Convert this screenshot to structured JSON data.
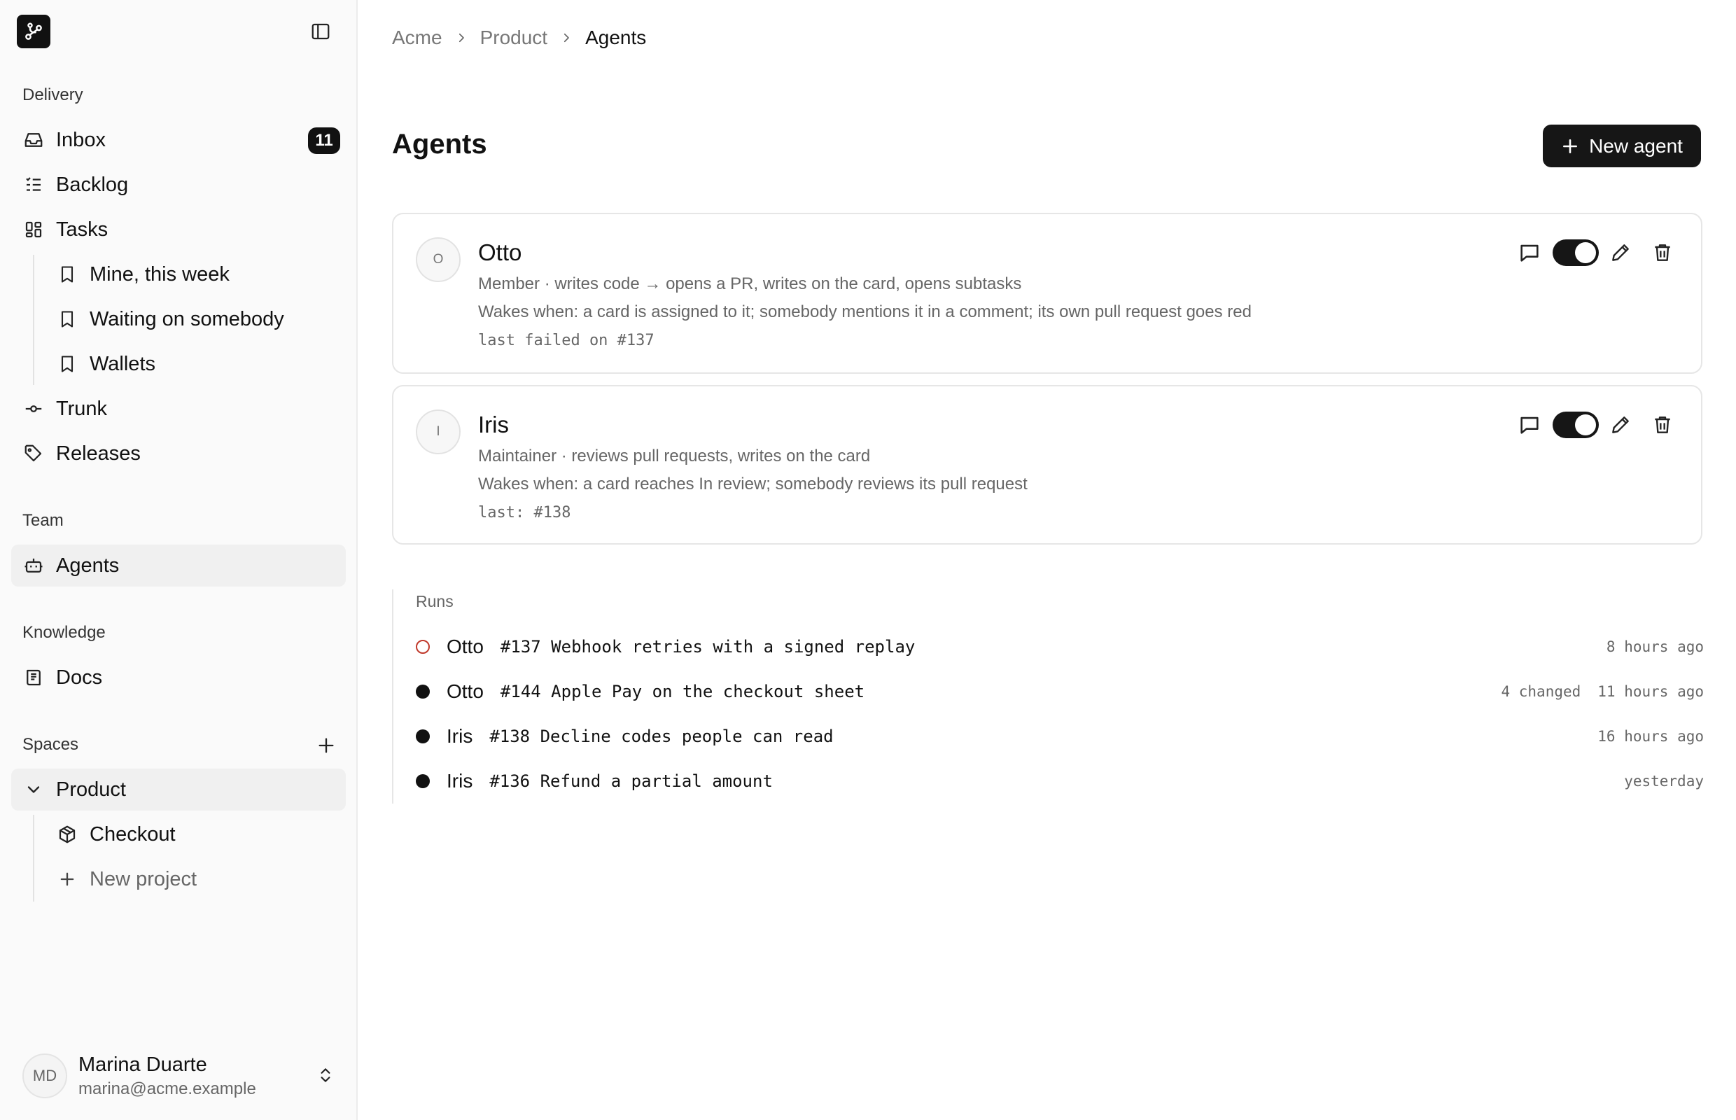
{
  "sidebar": {
    "logo_icon": "branch-logo-icon",
    "sections": {
      "delivery": "Delivery",
      "team": "Team",
      "knowledge": "Knowledge",
      "spaces": "Spaces"
    },
    "items": {
      "inbox": {
        "label": "Inbox",
        "badge": "11",
        "icon": "inbox-icon"
      },
      "backlog": {
        "label": "Backlog",
        "icon": "list-icon"
      },
      "tasks": {
        "label": "Tasks",
        "icon": "grid-icon"
      },
      "mine": {
        "label": "Mine, this week",
        "icon": "bookmark-icon"
      },
      "waiting": {
        "label": "Waiting on somebody",
        "icon": "bookmark-icon"
      },
      "wallets": {
        "label": "Wallets",
        "icon": "bookmark-icon"
      },
      "trunk": {
        "label": "Trunk",
        "icon": "commit-icon"
      },
      "releases": {
        "label": "Releases",
        "icon": "tag-icon"
      },
      "agents": {
        "label": "Agents",
        "icon": "bot-icon"
      },
      "docs": {
        "label": "Docs",
        "icon": "book-icon"
      },
      "product": {
        "label": "Product",
        "icon": "chevron-down-icon"
      },
      "checkout": {
        "label": "Checkout",
        "icon": "box-icon"
      },
      "new_project": {
        "label": "New project",
        "icon": "plus-icon"
      }
    },
    "user": {
      "initials": "MD",
      "name": "Marina Duarte",
      "email": "marina@acme.example"
    }
  },
  "breadcrumb": [
    "Acme",
    "Product",
    "Agents"
  ],
  "page": {
    "title": "Agents",
    "new_button": "New agent"
  },
  "agents": [
    {
      "initial": "O",
      "name": "Otto",
      "role": "Member · writes code → opens a PR, writes on the card, opens subtasks",
      "wakes": "Wakes when: a card is assigned to it; somebody mentions it in a comment; its own pull request goes red",
      "last": "last failed on #137",
      "enabled": true
    },
    {
      "initial": "I",
      "name": "Iris",
      "role": "Maintainer · reviews pull requests, writes on the card",
      "wakes": "Wakes when: a card reaches In review; somebody reviews its pull request",
      "last": "last: #138",
      "enabled": true
    }
  ],
  "runs": {
    "heading": "Runs",
    "items": [
      {
        "status": "failed",
        "agent": "Otto",
        "title": "#137 Webhook retries with a signed replay",
        "changed": "",
        "time": "8 hours ago"
      },
      {
        "status": "done",
        "agent": "Otto",
        "title": "#144 Apple Pay on the checkout sheet",
        "changed": "4 changed",
        "time": "11 hours ago"
      },
      {
        "status": "done",
        "agent": "Iris",
        "title": "#138 Decline codes people can read",
        "changed": "",
        "time": "16 hours ago"
      },
      {
        "status": "done",
        "agent": "Iris",
        "title": "#136 Refund a partial amount",
        "changed": "",
        "time": "yesterday"
      }
    ]
  },
  "colors": {
    "accent": "#161616",
    "failed": "#c0392b",
    "muted_text": "#666666"
  }
}
